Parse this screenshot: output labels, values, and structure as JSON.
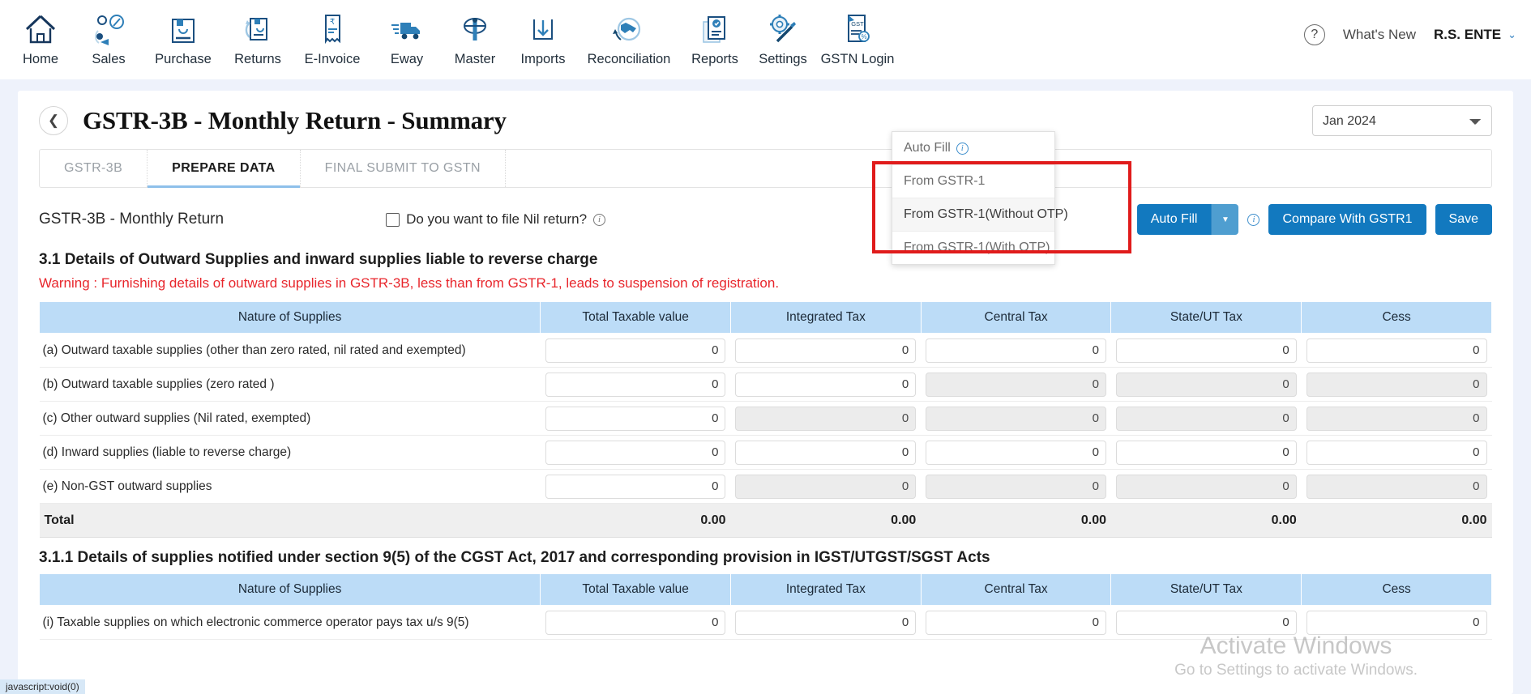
{
  "topnav": {
    "items": [
      {
        "label": "Home",
        "icon": "home-icon"
      },
      {
        "label": "Sales",
        "icon": "sales-icon"
      },
      {
        "label": "Purchase",
        "icon": "purchase-icon"
      },
      {
        "label": "Returns",
        "icon": "returns-icon"
      },
      {
        "label": "E-Invoice",
        "icon": "einvoice-icon"
      },
      {
        "label": "Eway",
        "icon": "eway-truck-icon"
      },
      {
        "label": "Master",
        "icon": "master-icon"
      },
      {
        "label": "Imports",
        "icon": "imports-download-icon"
      },
      {
        "label": "Reconciliation",
        "icon": "reconciliation-handshake-icon"
      },
      {
        "label": "Reports",
        "icon": "reports-icon"
      },
      {
        "label": "Settings",
        "icon": "settings-gear-icon"
      },
      {
        "label": "GSTN Login",
        "icon": "gstn-login-icon"
      }
    ],
    "help_icon": "question-mark-icon",
    "whats_new": "What's New",
    "user": "R.S. ENTE",
    "user_caret": "⌄"
  },
  "page": {
    "back_icon": "chevron-left-icon",
    "title": "GSTR-3B - Monthly Return - Summary",
    "period_selected": "Jan 2024",
    "period_options": [
      "Jan 2024"
    ]
  },
  "tabs": [
    {
      "label": "GSTR-3B",
      "active": false
    },
    {
      "label": "PREPARE DATA",
      "active": true
    },
    {
      "label": "FINAL SUBMIT TO GSTN",
      "active": false
    }
  ],
  "subhead": {
    "title": "GSTR-3B - Monthly Return",
    "nil_label": "Do you want to file Nil return?",
    "nil_checked": false,
    "nil_info_icon": "info-icon"
  },
  "toolbar": {
    "auto_fill_label": "Auto Fill",
    "auto_fill_caret": "▼",
    "info_icon": "info-icon",
    "compare_label": "Compare With GSTR1",
    "save_label": "Save"
  },
  "dropdown": {
    "open": true,
    "items": [
      {
        "label": "Auto Fill",
        "has_info": true,
        "hover": false
      },
      {
        "label": "From GSTR-1",
        "has_info": false,
        "hover": false
      },
      {
        "label": "From GSTR-1(Without OTP)",
        "has_info": false,
        "hover": true
      },
      {
        "label": "From GSTR-1(With OTP)",
        "has_info": false,
        "hover": false
      }
    ]
  },
  "section31": {
    "title": "3.1 Details of Outward Supplies and inward supplies liable to reverse charge",
    "warning": "Warning : Furnishing details of outward supplies in GSTR-3B, less than from GSTR-1, leads to suspension of registration.",
    "columns": [
      "Nature of Supplies",
      "Total Taxable value",
      "Integrated Tax",
      "Central Tax",
      "State/UT Tax",
      "Cess"
    ],
    "rows": [
      {
        "nature": "(a) Outward taxable supplies (other than zero rated, nil rated and exempted)",
        "values": [
          "0",
          "0",
          "0",
          "0",
          "0"
        ],
        "disabled": [
          false,
          false,
          false,
          false,
          false
        ]
      },
      {
        "nature": "(b) Outward taxable supplies (zero rated )",
        "values": [
          "0",
          "0",
          "0",
          "0",
          "0"
        ],
        "disabled": [
          false,
          false,
          true,
          true,
          true
        ]
      },
      {
        "nature": "(c) Other outward supplies (Nil rated, exempted)",
        "values": [
          "0",
          "0",
          "0",
          "0",
          "0"
        ],
        "disabled": [
          false,
          true,
          true,
          true,
          true
        ]
      },
      {
        "nature": "(d) Inward supplies (liable to reverse charge)",
        "values": [
          "0",
          "0",
          "0",
          "0",
          "0"
        ],
        "disabled": [
          false,
          false,
          false,
          false,
          false
        ]
      },
      {
        "nature": "(e) Non-GST outward supplies",
        "values": [
          "0",
          "0",
          "0",
          "0",
          "0"
        ],
        "disabled": [
          false,
          true,
          true,
          true,
          true
        ]
      }
    ],
    "total": {
      "label": "Total",
      "values": [
        "0.00",
        "0.00",
        "0.00",
        "0.00",
        "0.00"
      ]
    }
  },
  "section311": {
    "title": "3.1.1 Details of supplies notified under section 9(5) of the CGST Act, 2017 and corresponding provision in IGST/UTGST/SGST Acts",
    "columns": [
      "Nature of Supplies",
      "Total Taxable value",
      "Integrated Tax",
      "Central Tax",
      "State/UT Tax",
      "Cess"
    ],
    "rows": [
      {
        "nature": "(i) Taxable supplies on which electronic commerce operator pays tax u/s 9(5)",
        "values": [
          "0",
          "0",
          "0",
          "0",
          "0"
        ],
        "disabled": [
          false,
          false,
          false,
          false,
          false
        ]
      }
    ]
  },
  "watermark": {
    "line1": "Activate Windows",
    "line2": "Go to Settings to activate Windows."
  },
  "statusbar": {
    "text": "javascript:void(0)"
  },
  "colors": {
    "primary": "#1279bf",
    "table_header": "#bcdcf7",
    "warning": "#e8262c",
    "annotation": "#e01b1b"
  }
}
